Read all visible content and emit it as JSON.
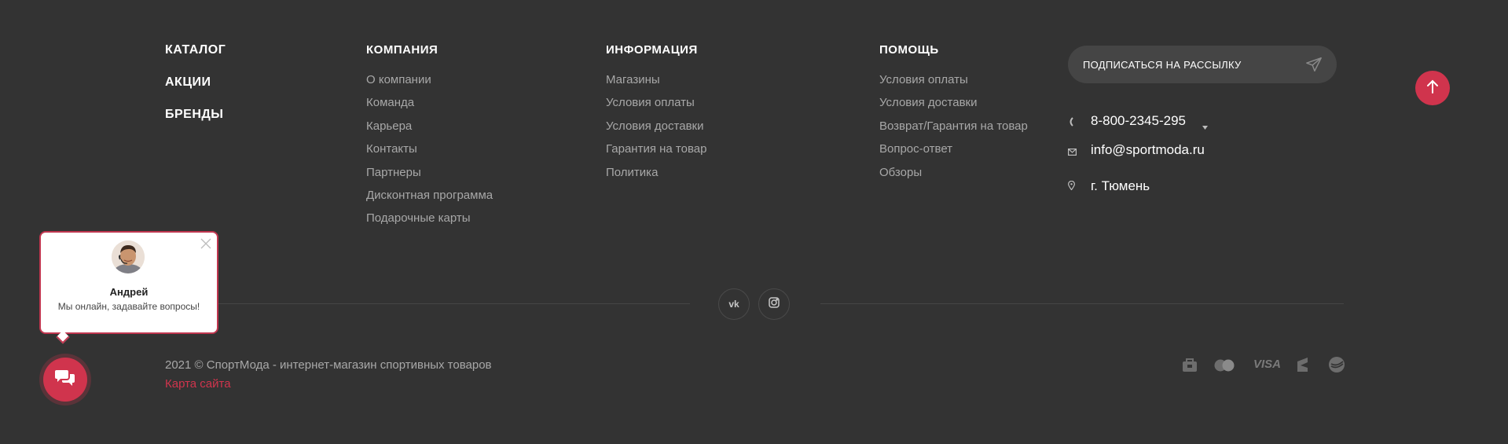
{
  "catalog_links": [
    "КАТАЛОГ",
    "АКЦИИ",
    "БРЕНДЫ"
  ],
  "company": {
    "title": "КОМПАНИЯ",
    "items": [
      "О компании",
      "Команда",
      "Карьера",
      "Контакты",
      "Партнеры",
      "Дисконтная программа",
      "Подарочные карты"
    ]
  },
  "information": {
    "title": "ИНФОРМАЦИЯ",
    "items": [
      "Магазины",
      "Условия оплаты",
      "Условия доставки",
      "Гарантия на товар",
      "Политика"
    ]
  },
  "help": {
    "title": "ПОМОЩЬ",
    "items": [
      "Условия оплаты",
      "Условия доставки",
      "Возврат/Гарантия на товар",
      "Вопрос-ответ",
      "Обзоры"
    ]
  },
  "subscribe": {
    "label": "ПОДПИСАТЬСЯ НА РАССЫЛКУ",
    "icon": "paper-plane-icon"
  },
  "contacts": {
    "phone": "8-800-2345-295",
    "email": "info@sportmoda.ru",
    "city": "г. Тюмень"
  },
  "social": [
    {
      "name": "vk",
      "label": "vk"
    },
    {
      "name": "instagram",
      "icon": "instagram-icon"
    }
  ],
  "footer": {
    "copyright": "2021 © СпортМода - интернет-магазин спортивных товаров",
    "sitemap": "Карта сайта"
  },
  "payment_icons": [
    "sberbank-bag-icon",
    "mastercard-icon",
    "visa-icon",
    "yandex-money-icon",
    "sberbank-icon"
  ],
  "chat": {
    "operator_name": "Андрей",
    "message": "Мы онлайн, задавайте вопросы!"
  },
  "colors": {
    "background": "#333333",
    "accent": "#d0344d",
    "muted_text": "#a8a8a8"
  }
}
